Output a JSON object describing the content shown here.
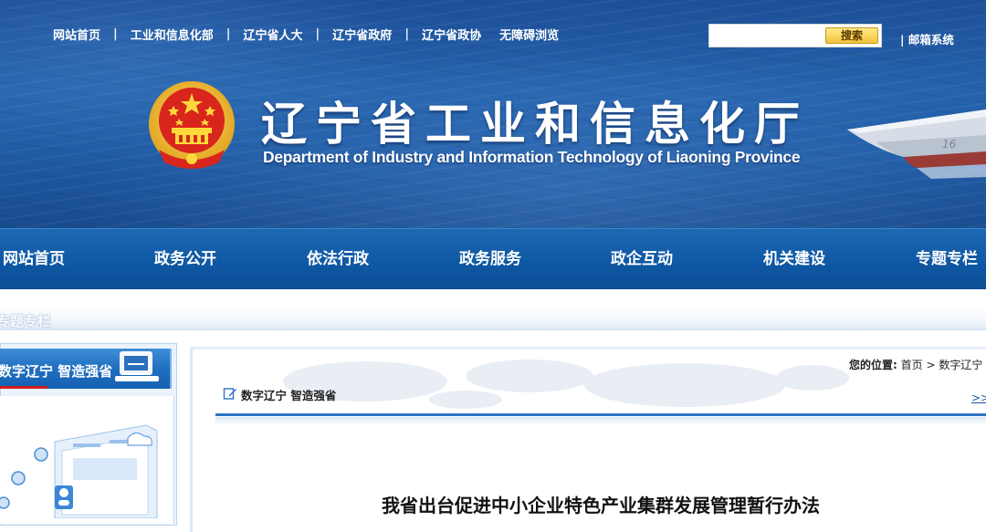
{
  "header": {
    "top_links": [
      "网站首页",
      "工业和信息化部",
      "辽宁省人大",
      "辽宁省政府",
      "辽宁省政协",
      "无障碍浏览"
    ],
    "search": {
      "placeholder": "",
      "button_label": "搜索"
    },
    "mail_link": "| 邮箱系统",
    "title_cn": "辽宁省工业和信息化厅",
    "title_en": "Department of Industry and Information Technology of Liaoning Province",
    "ship_hull_number": "16"
  },
  "nav": {
    "items": [
      "网站首页",
      "政务公开",
      "依法行政",
      "政务服务",
      "政企互动",
      "机关建设",
      "专题专栏"
    ]
  },
  "band": {
    "text": "专题专栏"
  },
  "sidebar": {
    "heading": "数字辽宁 智造强省"
  },
  "content": {
    "breadcrumb": {
      "label": "您的位置:",
      "home": "首页",
      "sep": ">",
      "current": "数字辽宁"
    },
    "section_heading": "数字辽宁 智造强省",
    "more_link": ">>",
    "article_title": "我省出台促进中小企业特色产业集群发展管理暂行办法"
  },
  "colors": {
    "nav_bg": "#0f58a4",
    "accent_red": "#d11e1e",
    "search_button": "#f3c33a"
  }
}
